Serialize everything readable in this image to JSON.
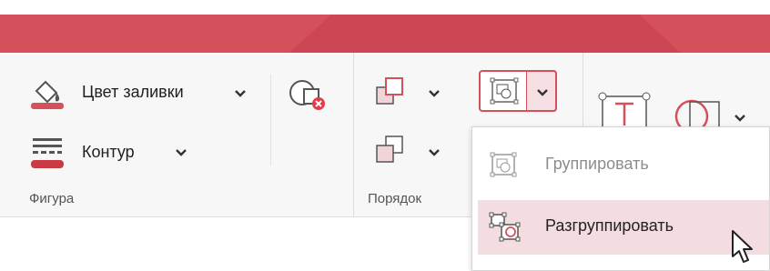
{
  "colors": {
    "accent": "#d4505a",
    "hover": "#f3dde0"
  },
  "groups": {
    "shape": {
      "label": "Фигура",
      "fill_label": "Цвет заливки",
      "outline_label": "Контур"
    },
    "order": {
      "label": "Порядок"
    }
  },
  "group_menu": {
    "items": [
      {
        "label": "Группировать",
        "enabled": false
      },
      {
        "label": "Разгруппировать",
        "enabled": true,
        "hovered": true
      }
    ]
  },
  "icons": {
    "fill": "fill-color-icon",
    "outline": "outline-icon",
    "shape_remove": "shape-delete-icon",
    "bring_forward": "bring-forward-icon",
    "send_backward": "send-backward-icon",
    "group": "group-icon",
    "ungroup": "ungroup-icon",
    "text_box": "text-box-icon",
    "shapes": "shapes-icon",
    "cursor": "mouse-cursor-icon"
  }
}
